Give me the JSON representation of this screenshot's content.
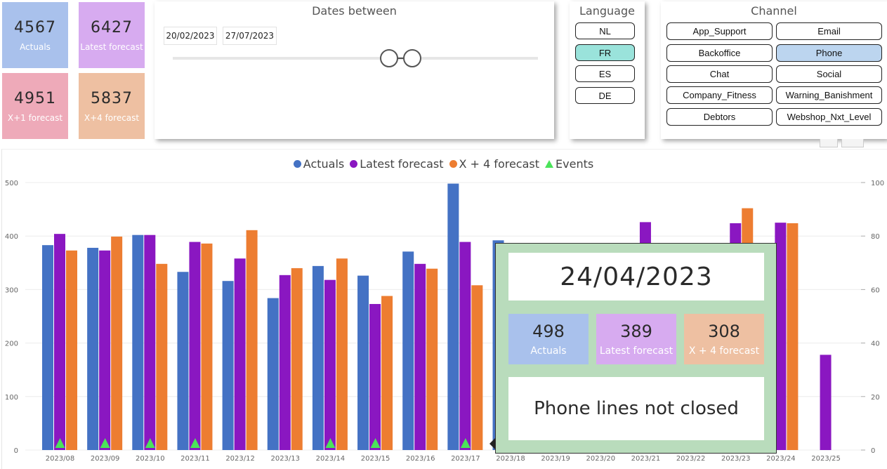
{
  "kpis": [
    {
      "value": "4567",
      "label": "Actuals",
      "color": "#a9c1ec"
    },
    {
      "value": "6427",
      "label": "Latest forecast",
      "color": "#d7abf0"
    },
    {
      "value": "4951",
      "label": "X+1 forecast",
      "color": "#eeaab9"
    },
    {
      "value": "5837",
      "label": "X+4 forecast",
      "color": "#eec0a2"
    }
  ],
  "dates": {
    "title": "Dates between",
    "start": "20/02/2023",
    "end": "27/07/2023"
  },
  "language": {
    "title": "Language",
    "options": [
      "NL",
      "FR",
      "ES",
      "DE"
    ],
    "selected": "FR"
  },
  "channel": {
    "title": "Channel",
    "options": [
      "App_Support",
      "Email",
      "Backoffice",
      "Phone",
      "Chat",
      "Social",
      "Company_Fitness",
      "Warning_Banishment",
      "Debtors",
      "Webshop_Nxt_Level"
    ],
    "selected": "Phone"
  },
  "legend": {
    "actuals": "Actuals",
    "latest": "Latest forecast",
    "x4": "X + 4 forecast",
    "events": "Events"
  },
  "colors": {
    "actuals": "#4472c4",
    "latest": "#8a17c1",
    "x4": "#ed7d31",
    "events": "#4be35a",
    "tooltip_bg": "#b9dcbc",
    "selected_lang": "#9ae3db",
    "selected_channel": "#bcd5ef"
  },
  "chart_data": {
    "type": "bar",
    "categories": [
      "2023/08",
      "2023/09",
      "2023/10",
      "2023/11",
      "2023/12",
      "2023/13",
      "2023/14",
      "2023/15",
      "2023/16",
      "2023/17",
      "2023/18",
      "2023/19",
      "2023/20",
      "2023/21",
      "2023/22",
      "2023/23",
      "2023/24",
      "2023/25"
    ],
    "series": [
      {
        "name": "Actuals",
        "values": [
          383,
          378,
          402,
          333,
          316,
          284,
          344,
          326,
          371,
          498,
          392,
          null,
          null,
          null,
          null,
          null,
          null,
          null
        ]
      },
      {
        "name": "Latest forecast",
        "values": [
          404,
          373,
          402,
          389,
          358,
          327,
          318,
          273,
          348,
          389,
          null,
          null,
          null,
          426,
          null,
          424,
          425,
          178
        ]
      },
      {
        "name": "X + 4 forecast",
        "values": [
          373,
          399,
          348,
          386,
          411,
          340,
          358,
          288,
          339,
          308,
          null,
          null,
          null,
          null,
          null,
          452,
          424,
          null
        ]
      }
    ],
    "events": [
      "2023/08",
      "2023/09",
      "2023/10",
      "2023/11",
      "2023/14",
      "2023/15",
      "2023/17"
    ],
    "y_ticks": [
      "0",
      "100",
      "200",
      "300",
      "400",
      "500"
    ],
    "y2_ticks": [
      "0",
      "20",
      "40",
      "60",
      "80",
      "100"
    ],
    "ylim": [
      0,
      500
    ],
    "y2lim": [
      0,
      100
    ],
    "legend_position": "top-center",
    "grid": true
  },
  "tooltip": {
    "date": "24/04/2023",
    "actuals_value": "498",
    "actuals_label": "Actuals",
    "latest_value": "389",
    "latest_label": "Latest forecast",
    "x4_value": "308",
    "x4_label": "X + 4 forecast",
    "note": "Phone lines not closed"
  }
}
